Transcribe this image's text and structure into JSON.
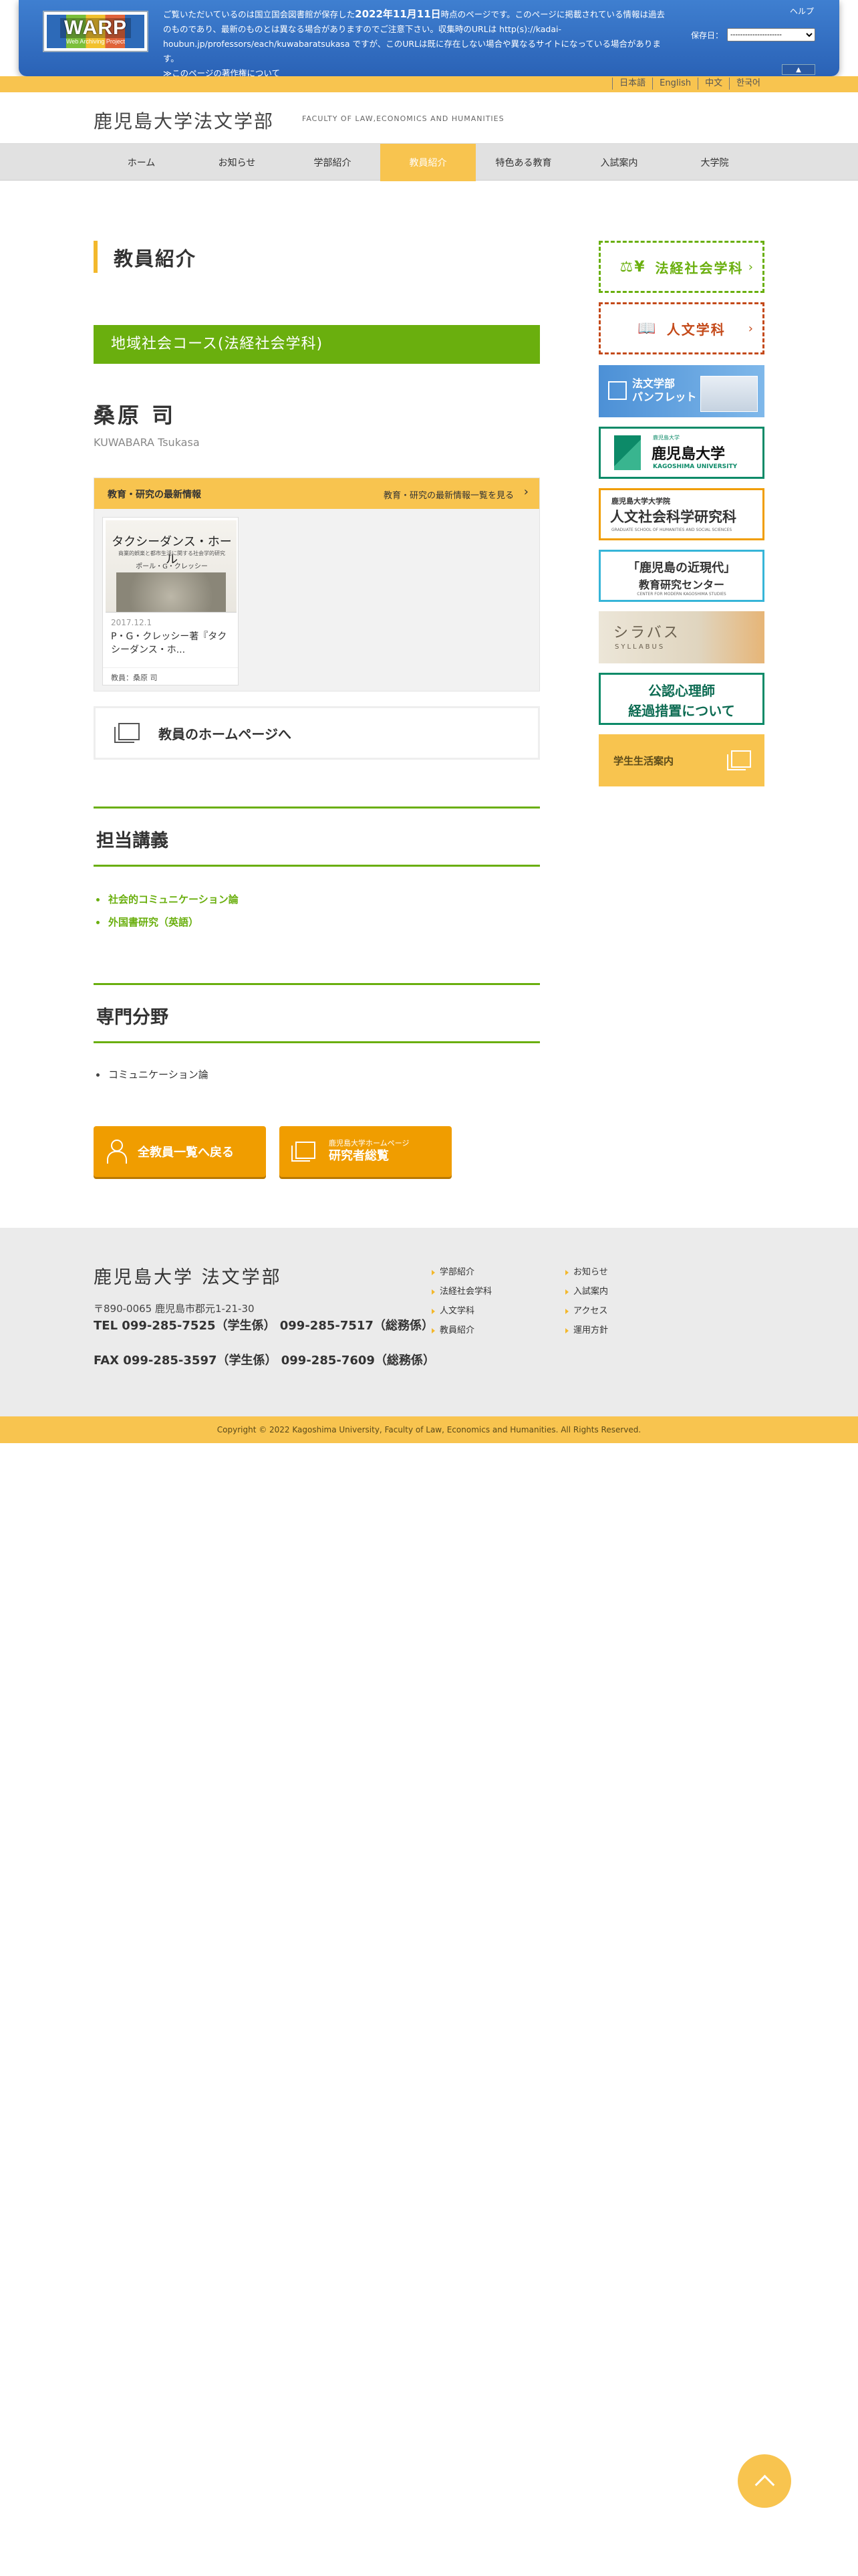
{
  "warp": {
    "logo_text": "WARP",
    "logo_sub": "Web Archiving Project",
    "line1_pre": "ご覧いただいているのは国立国会図書館が保存した",
    "line1_date": "2022年11月11日",
    "line1_post": "時点のページです。このページに掲載されている情報は過去",
    "line2": "のものであり、最新のものとは異なる場合がありますのでご注意下さい。収集時のURLは http(s)://kadai-",
    "line3": "houbun.jp/professors/each/kuwabaratsukasa ですが、このURLは既に存在しない場合や異なるサイトになっている場合がありま",
    "line4": "す。",
    "copyright_link": "≫このページの著作権について",
    "help": "ヘルプ",
    "save_label": "保存日：",
    "save_value": "---------------------",
    "toggle": "▲"
  },
  "lang": [
    "日本語",
    "English",
    "中文",
    "한국어"
  ],
  "header": {
    "title": "鹿児島大学法文学部",
    "subtitle": "FACULTY OF LAW,ECONOMICS AND HUMANITIES"
  },
  "nav": [
    "ホーム",
    "お知らせ",
    "学部紹介",
    "教員紹介",
    "特色ある教育",
    "入試案内",
    "大学院"
  ],
  "main": {
    "page_title": "教員紹介",
    "course": "地域社会コース(法経社会学科)",
    "name": "桑原 司",
    "romaji": "KUWABARA Tsukasa",
    "news": {
      "heading": "教育・研究の最新情報",
      "more": "教育・研究の最新情報一覧を見る",
      "card": {
        "book_title": "タクシーダンス・ホール",
        "book_sub": "商業的娯楽と都市生活に関する社会学的研究",
        "book_author": "ポール・G・クレッシー",
        "date": "2017.12.1",
        "title": "P・G・クレッシー著『タクシーダンス・ホ...",
        "tag": "教員：桑原 司"
      }
    },
    "homepage_button": "教員のホームページへ",
    "lectures_heading": "担当講義",
    "lectures": [
      "社会的コミュニケーション論",
      "外国書研究（英語）"
    ],
    "specialty_heading": "専門分野",
    "specialty": [
      "コミュニケーション論"
    ],
    "back_button": "全教員一覧へ戻る",
    "research_button_small": "鹿児島大学ホームページ",
    "research_button": "研究者総覧"
  },
  "sidebar": {
    "law": "法経社会学科",
    "law_icon": "⚖¥",
    "humanities": "人文学科",
    "pamphlet": [
      "法文学部",
      "パンフレット"
    ],
    "ku_small": "鹿児島大学",
    "ku_name": "鹿児島大学",
    "ku_en": "KAGOSHIMA UNIVERSITY",
    "grad_a": "鹿児島大学大学院",
    "grad_b": "人文社会科学研究科",
    "grad_c": "GRADUATE SCHOOL OF HUMANITIES AND SOCIAL SCIENCES",
    "center_a": "「鹿児島の近現代」",
    "center_b": "教育研究センター",
    "center_c": "CENTER FOR MODERN KAGOSHIMA STUDIES",
    "syllabus_a": "シラバス",
    "syllabus_b": "SYLLABUS",
    "psy_a": "公認心理師",
    "psy_b": "経過措置について",
    "life": "学生生活案内"
  },
  "footer": {
    "title": "鹿児島大学 法文学部",
    "address": "〒890-0065 鹿児島市郡元1-21-30",
    "tel": "TEL 099-285-7525（学生係） 099-285-7517（総務係）",
    "fax": "FAX 099-285-3597（学生係） 099-285-7609（総務係）",
    "links1": [
      "学部紹介",
      "法経社会学科",
      "人文学科",
      "教員紹介"
    ],
    "links2": [
      "お知らせ",
      "入試案内",
      "アクセス",
      "運用方針"
    ],
    "copyright": "Copyright © 2022 Kagoshima University, Faculty of Law, Economics and Humanities. All Rights Reserved."
  },
  "colors": {
    "accent_yellow": "#f8c44f",
    "accent_green": "#6aaf0e",
    "warp_blue": "#2a62b6",
    "button_orange": "#f09d00"
  }
}
